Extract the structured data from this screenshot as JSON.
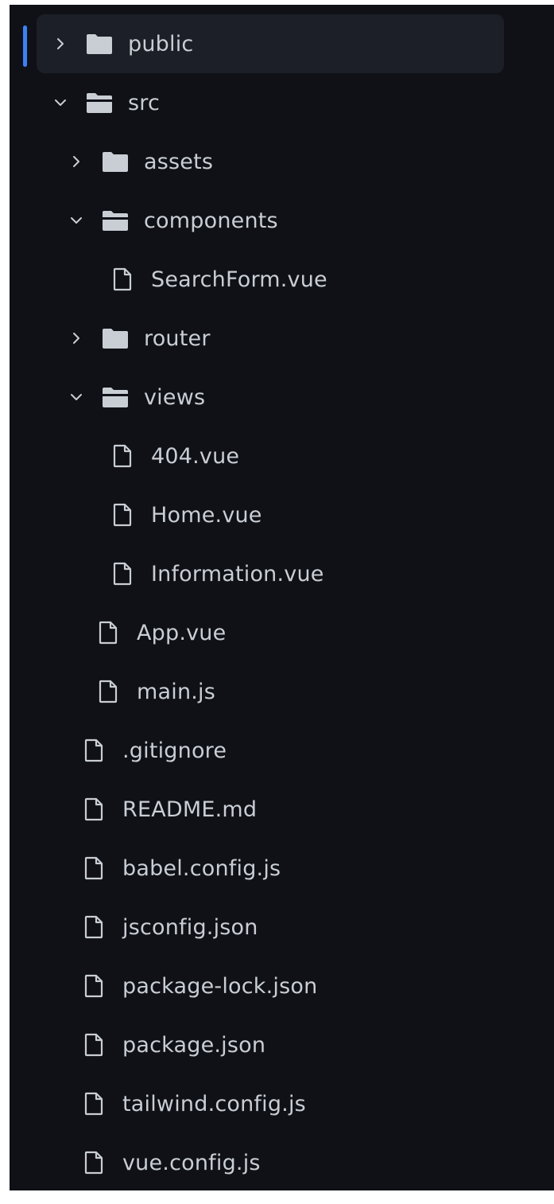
{
  "explorer": {
    "colors": {
      "background": "#0f1117",
      "selection": "#1c1f27",
      "accent": "#3b82f6",
      "text": "#c9cdd4",
      "icon": "#c9cdd4"
    },
    "items": [
      {
        "label": "public",
        "kind": "folder",
        "expanded": false,
        "depth": 0,
        "selected": true
      },
      {
        "label": "src",
        "kind": "folder",
        "expanded": true,
        "depth": 0
      },
      {
        "label": "assets",
        "kind": "folder",
        "expanded": false,
        "depth": 1
      },
      {
        "label": "components",
        "kind": "folder",
        "expanded": true,
        "depth": 1
      },
      {
        "label": "SearchForm.vue",
        "kind": "file",
        "depth": 2
      },
      {
        "label": "router",
        "kind": "folder",
        "expanded": false,
        "depth": 1
      },
      {
        "label": "views",
        "kind": "folder",
        "expanded": true,
        "depth": 1
      },
      {
        "label": "404.vue",
        "kind": "file",
        "depth": 2
      },
      {
        "label": "Home.vue",
        "kind": "file",
        "depth": 2
      },
      {
        "label": "Information.vue",
        "kind": "file",
        "depth": 2
      },
      {
        "label": "App.vue",
        "kind": "file",
        "depth": 1
      },
      {
        "label": "main.js",
        "kind": "file",
        "depth": 1
      },
      {
        "label": ".gitignore",
        "kind": "file",
        "depth": 0
      },
      {
        "label": "README.md",
        "kind": "file",
        "depth": 0
      },
      {
        "label": "babel.config.js",
        "kind": "file",
        "depth": 0
      },
      {
        "label": "jsconfig.json",
        "kind": "file",
        "depth": 0
      },
      {
        "label": "package-lock.json",
        "kind": "file",
        "depth": 0
      },
      {
        "label": "package.json",
        "kind": "file",
        "depth": 0
      },
      {
        "label": "tailwind.config.js",
        "kind": "file",
        "depth": 0
      },
      {
        "label": "vue.config.js",
        "kind": "file",
        "depth": 0
      }
    ]
  }
}
